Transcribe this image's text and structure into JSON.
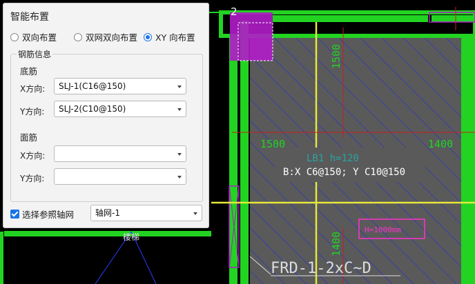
{
  "dialog": {
    "title": "智能布置",
    "radios": [
      {
        "label": "双向布置",
        "checked": false
      },
      {
        "label": "双网双向布置",
        "checked": false
      },
      {
        "label": "XY 向布置",
        "checked": true
      }
    ],
    "group_title": "钢筋信息",
    "bottom_label": "底筋",
    "top_label": "面筋",
    "x_label": "X方向:",
    "y_label": "Y方向:",
    "bottom_x_value": "SLJ-1(C16@150)",
    "bottom_y_value": "SLJ-2(C10@150)",
    "top_x_value": "",
    "top_y_value": "",
    "ref_axis_label": "选择参照轴网",
    "ref_axis_checked": true,
    "ref_axis_value": "轴网-1"
  },
  "canvas": {
    "marker_number": "2",
    "dim_left": "1500",
    "dim_right": "1400",
    "dim_vertical_top": "1500",
    "dim_vertical_bottom": "1400",
    "slab_label": "LB1  h=120",
    "rebar_text": "B:X  C6@150; Y      C10@150",
    "foundation_text": "FRD-1-2xC~D",
    "stair_text": "楼梯",
    "pink_label": "H=1000mm",
    "colors": {
      "background": "#000000",
      "wall_green": "#22d322",
      "slab_fill": "#5a5a5a",
      "hatch_blue": "#1f2fd8",
      "axis_yellow": "#e8e83a",
      "magenta": "#b01cc8"
    }
  }
}
